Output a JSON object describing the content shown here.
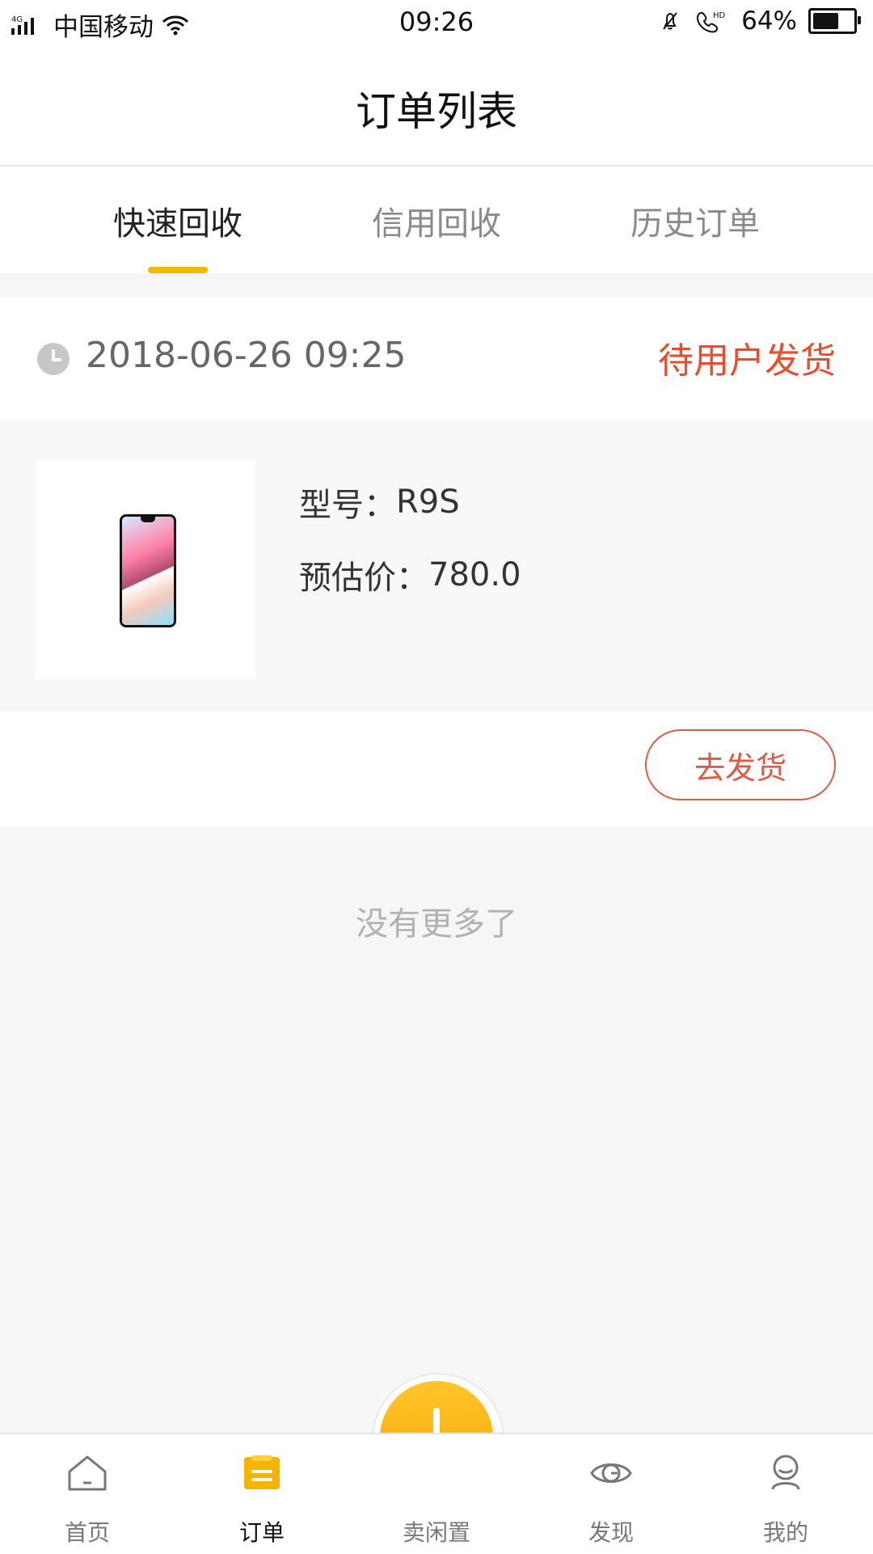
{
  "status_bar": {
    "network": "4G",
    "carrier": "中国移动",
    "time": "09:26",
    "hd": "HD",
    "battery_percent": "64%",
    "battery_level": 0.64
  },
  "header": {
    "title": "订单列表"
  },
  "tabs": [
    {
      "label": "快速回收",
      "active": true
    },
    {
      "label": "信用回收",
      "active": false
    },
    {
      "label": "历史订单",
      "active": false
    }
  ],
  "order": {
    "time": "2018-06-26 09:25",
    "status": "待用户发货",
    "model_label": "型号：",
    "model_value": "R9S",
    "price_label": "预估价：",
    "price_value": "780.0",
    "action_label": "去发货"
  },
  "list_end_text": "没有更多了",
  "bottom_nav": {
    "home": "首页",
    "orders": "订单",
    "sell": "卖闲置",
    "discover": "发现",
    "mine": "我的"
  },
  "colors": {
    "accent": "#f5b800",
    "status_red": "#ea4d2b",
    "button_red": "#e05a43"
  }
}
